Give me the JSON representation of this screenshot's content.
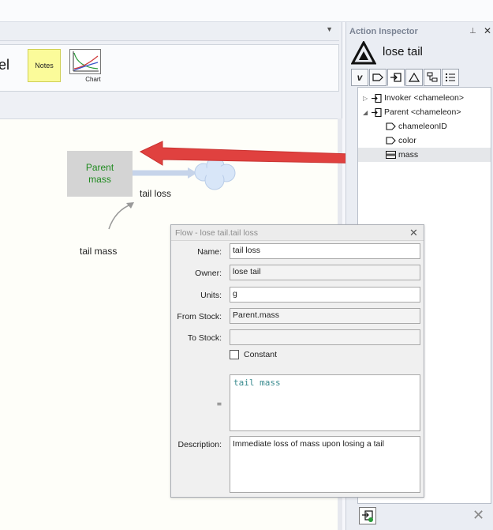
{
  "ribbon": {
    "partial_label": "el",
    "notes_label": "Notes",
    "chart_label": "Chart"
  },
  "canvas": {
    "stock_label": "Parent\nmass",
    "flow_label": "tail loss",
    "variable_label": "tail mass"
  },
  "inspector": {
    "title": "Action Inspector",
    "action_name": "lose tail",
    "tabs": [
      "trigger",
      "tag",
      "import",
      "triangle",
      "flowchart",
      "list"
    ],
    "tree": [
      {
        "label": "Invoker <chameleon>",
        "level": 0,
        "expander": "collapsed",
        "icon": "import-icon"
      },
      {
        "label": "Parent <chameleon>",
        "level": 0,
        "expander": "expanded",
        "icon": "import-icon"
      },
      {
        "label": "chameleonID",
        "level": 1,
        "expander": "none",
        "icon": "tag-icon"
      },
      {
        "label": "color",
        "level": 1,
        "expander": "none",
        "icon": "tag-icon"
      },
      {
        "label": "mass",
        "level": 1,
        "expander": "none",
        "icon": "stock-icon",
        "selected": true
      }
    ]
  },
  "flow_dialog": {
    "title": "Flow - lose tail.tail loss",
    "name_label": "Name:",
    "name_value": "tail loss",
    "owner_label": "Owner:",
    "owner_value": "lose tail",
    "units_label": "Units:",
    "units_value": "g",
    "from_stock_label": "From Stock:",
    "from_stock_value": "Parent.mass",
    "to_stock_label": "To Stock:",
    "to_stock_value": "",
    "constant_label": "Constant",
    "equation_label": "=",
    "equation_value": "tail mass",
    "description_label": "Description:",
    "description_value": "Immediate loss of mass upon losing a tail"
  },
  "colors": {
    "arrow_red": "#e0413f",
    "stock_text": "#1f8a1f",
    "equation_text": "#3a8b8f",
    "notes_bg": "#fbfb9a"
  }
}
